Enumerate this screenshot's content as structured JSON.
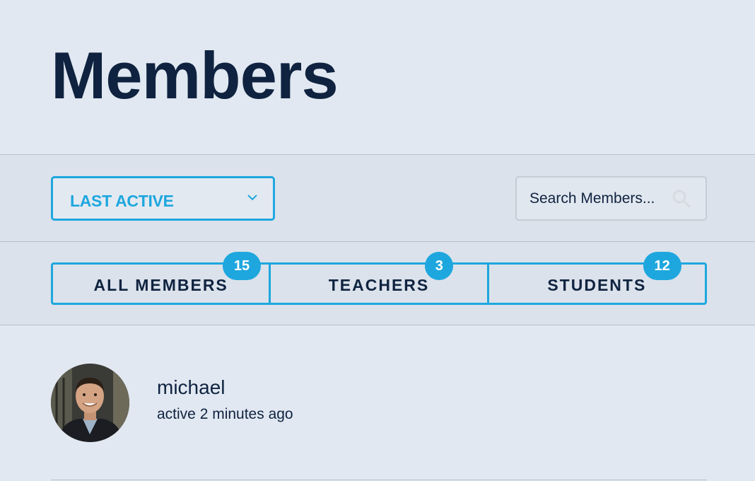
{
  "header": {
    "title": "Members"
  },
  "filters": {
    "sort_label": "LAST ACTIVE",
    "search_placeholder": "Search Members..."
  },
  "tabs": [
    {
      "label": "ALL MEMBERS",
      "count": "15"
    },
    {
      "label": "TEACHERS",
      "count": "3"
    },
    {
      "label": "STUDENTS",
      "count": "12"
    }
  ],
  "members": [
    {
      "name": "michael",
      "activity": "active 2 minutes ago"
    }
  ],
  "colors": {
    "accent": "#1ea7de",
    "text": "#0f2340",
    "background": "#e1e8f1"
  },
  "icons": {
    "sort": "chevron-down-icon",
    "search": "search-icon"
  }
}
